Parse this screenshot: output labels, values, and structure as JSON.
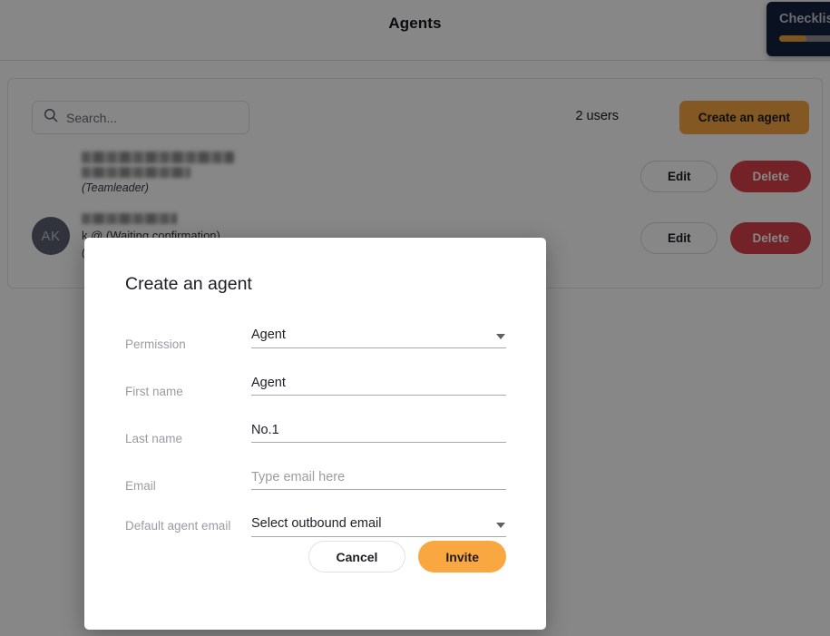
{
  "header": {
    "title": "Agents"
  },
  "checklist": {
    "title": "Checklist",
    "progress_percent": 25,
    "bar_color": "#e8a33d",
    "panel_color": "#14213d"
  },
  "toolbar": {
    "search_placeholder": "Search...",
    "search_value": "",
    "search_icon": "search-icon",
    "user_count_label": "2 users",
    "create_agent_label": "Create an agent",
    "accent_color": "#f9a740"
  },
  "agents": [
    {
      "avatar_initials": "",
      "name_redacted": true,
      "email_redacted": true,
      "meta": "(Teamleader)",
      "edit_label": "Edit",
      "delete_label": "Delete"
    },
    {
      "avatar_initials": "AK",
      "name_redacted": true,
      "email_line": "k        @          (Waiting confirmation)",
      "meta": "(A",
      "edit_label": "Edit",
      "delete_label": "Delete"
    }
  ],
  "modal": {
    "title": "Create an agent",
    "close_icon": "close-icon",
    "fields": [
      {
        "label": "Permission",
        "type": "select",
        "value": "Agent",
        "caret_icon": "chevron-down-icon"
      },
      {
        "label": "First name",
        "type": "text",
        "value": "Agent",
        "placeholder": ""
      },
      {
        "label": "Last name",
        "type": "text",
        "value": "No.1",
        "placeholder": ""
      },
      {
        "label": "Email",
        "type": "text",
        "value": "",
        "placeholder": "Type email here"
      },
      {
        "label": "Default agent email",
        "type": "select",
        "value": "Select outbound email",
        "caret_icon": "chevron-down-icon"
      }
    ],
    "cancel_label": "Cancel",
    "invite_label": "Invite",
    "invite_color": "#f9a740"
  },
  "colors": {
    "delete_red": "#d9404a",
    "scrim": "rgba(0,0,0,0.47)"
  }
}
